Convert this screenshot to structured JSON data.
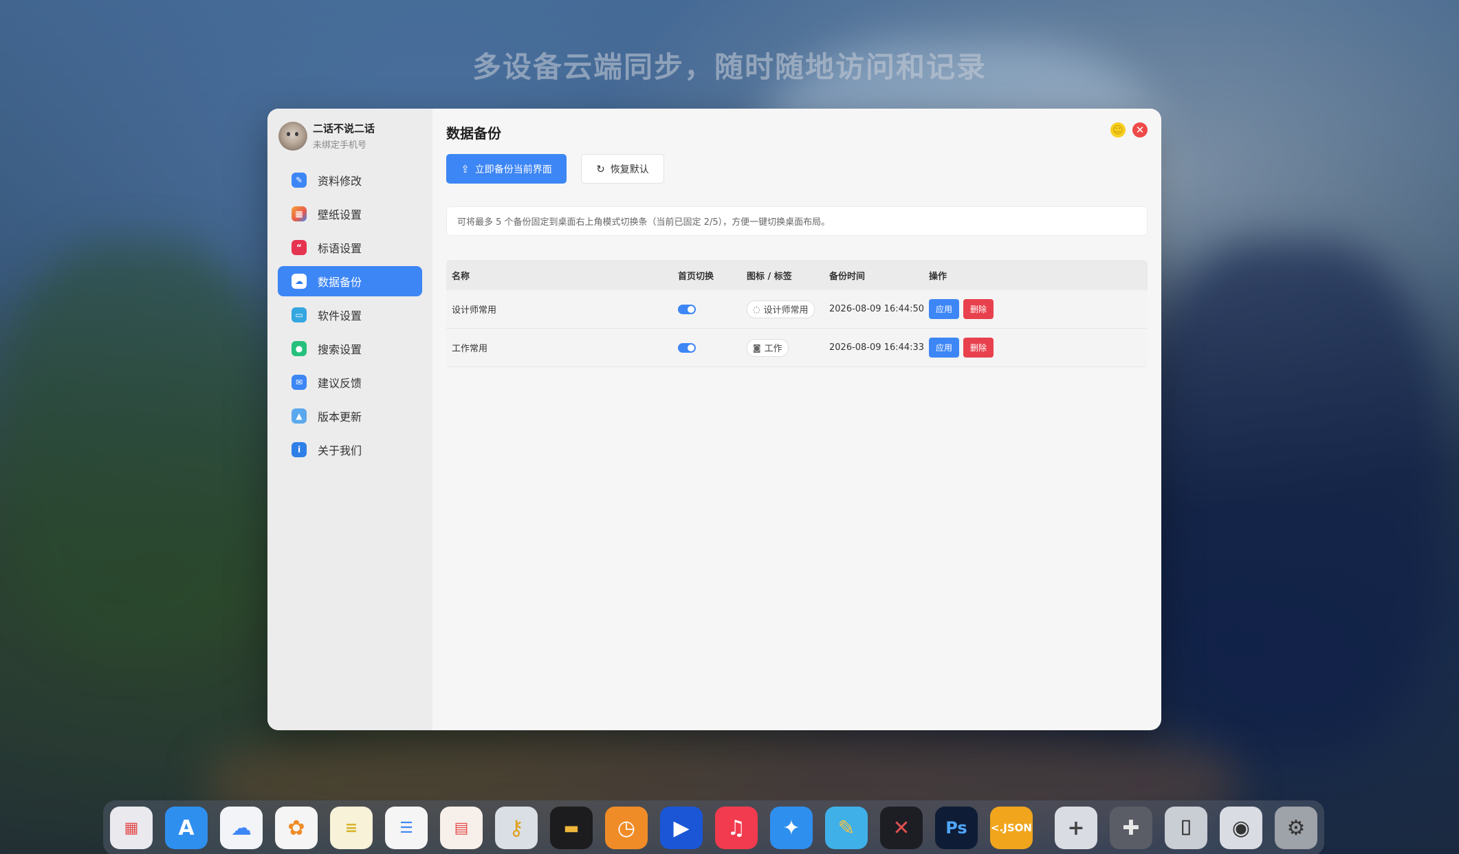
{
  "headline": "多设备云端同步，随时随地访问和记录",
  "profile": {
    "name": "二话不说二话",
    "subtitle": "未绑定手机号"
  },
  "sidebar": {
    "items": [
      {
        "label": "资料修改",
        "icon": "profile-edit-icon",
        "color": "#3d86f5"
      },
      {
        "label": "壁纸设置",
        "icon": "wallpaper-icon",
        "color": "#e7584c"
      },
      {
        "label": "标语设置",
        "icon": "quote-icon",
        "color": "#e6334f"
      },
      {
        "label": "数据备份",
        "icon": "cloud-backup-icon",
        "color": "#2f7fe8",
        "active": true
      },
      {
        "label": "软件设置",
        "icon": "software-settings-icon",
        "color": "#34a6e0"
      },
      {
        "label": "搜索设置",
        "icon": "search-settings-icon",
        "color": "#26c07d"
      },
      {
        "label": "建议反馈",
        "icon": "feedback-icon",
        "color": "#3d86f5"
      },
      {
        "label": "版本更新",
        "icon": "update-icon",
        "color": "#5aa8ee"
      },
      {
        "label": "关于我们",
        "icon": "info-icon",
        "color": "#2f7fe8"
      }
    ]
  },
  "main": {
    "title": "数据备份",
    "backup_button": "立即备份当前界面",
    "restore_button": "恢复默认",
    "notice": "可将最多 5 个备份固定到桌面右上角模式切换条（当前已固定 2/5），方便一键切换桌面布局。",
    "table": {
      "headers": [
        "名称",
        "首页切换",
        "图标 / 标签",
        "备份时间",
        "操作"
      ],
      "rows": [
        {
          "name": "设计师常用",
          "toggle": true,
          "tag_icon": "eye-slash-icon",
          "tag": "设计师常用",
          "time": "2026-08-09 16:44:50",
          "apply": "应用",
          "delete": "删除"
        },
        {
          "name": "工作常用",
          "toggle": true,
          "tag_icon": "camera-icon",
          "tag": "工作",
          "time": "2026-08-09 16:44:33",
          "apply": "应用",
          "delete": "删除"
        }
      ]
    }
  },
  "window_controls": {
    "minimize_icon": "minimize-icon",
    "close_icon": "close-icon"
  },
  "dock": {
    "apps": [
      {
        "name": "launchpad-icon",
        "color": "#e9e9ee"
      },
      {
        "name": "app-store-icon",
        "color": "#2f8fef"
      },
      {
        "name": "icloud-icon",
        "color": "#f2f4f8"
      },
      {
        "name": "photos-icon",
        "color": "#f5f5f5"
      },
      {
        "name": "notes-icon",
        "color": "#f7f2d8"
      },
      {
        "name": "reminders-icon",
        "color": "#f5f5f5"
      },
      {
        "name": "calendar-icon",
        "color": "#f7efe9"
      },
      {
        "name": "keychain-icon",
        "color": "#d9dfe4"
      },
      {
        "name": "wallet-icon",
        "color": "#1c1c1e"
      },
      {
        "name": "clock-icon",
        "color": "#f08c28"
      },
      {
        "name": "play-icon",
        "color": "#1a56d6"
      },
      {
        "name": "music-icon",
        "color": "#f23b4e"
      },
      {
        "name": "safari-icon",
        "color": "#2f8fef"
      },
      {
        "name": "sketch-pencil-icon",
        "color": "#3fb0e8"
      },
      {
        "name": "davinci-icon",
        "color": "#1d1d24"
      },
      {
        "name": "photoshop-icon",
        "color": "#0f1c36"
      },
      {
        "name": "json-icon",
        "color": "#f0a51d"
      },
      {
        "name": "add-icon",
        "color": "#d9dce2"
      },
      {
        "name": "puzzle-icon",
        "color": "#5a5d66"
      },
      {
        "name": "brush-icon",
        "color": "#c9cdd4"
      },
      {
        "name": "lock-settings-icon",
        "color": "#d9dce2"
      },
      {
        "name": "system-settings-icon",
        "color": "#9ea2a9"
      }
    ]
  }
}
